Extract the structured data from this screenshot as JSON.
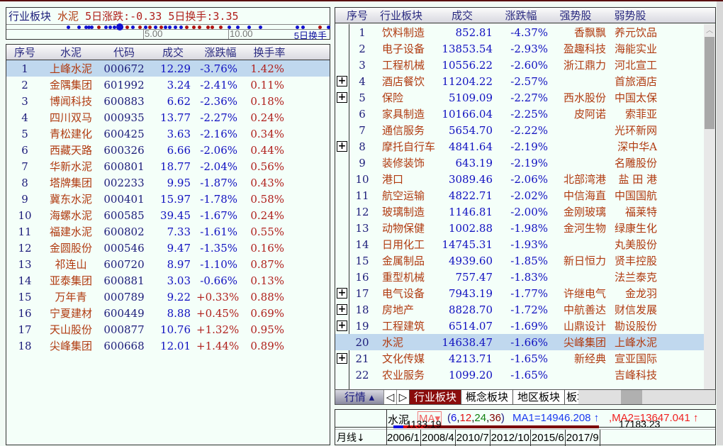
{
  "info": {
    "sector_label": "行业板块",
    "sector_name": "水泥",
    "change5_label": "5日涨跌:-0.33",
    "turnover5_label": "5日换手:3.35",
    "axis_ticks": [
      "5.00",
      "10.00"
    ],
    "axis_label": "5日换手"
  },
  "left_table": {
    "headers": [
      "序号",
      "水泥",
      "代码",
      "成交",
      "涨跌幅",
      "换手率"
    ],
    "rows": [
      [
        "1",
        "上峰水泥",
        "000672",
        "12.29",
        "-3.76%",
        "1.42%"
      ],
      [
        "2",
        "金隅集团",
        "601992",
        "3.24",
        "-2.41%",
        "0.11%"
      ],
      [
        "3",
        "博闻科技",
        "600883",
        "6.62",
        "-2.36%",
        "0.18%"
      ],
      [
        "4",
        "四川双马",
        "000935",
        "13.77",
        "-2.27%",
        "0.24%"
      ],
      [
        "5",
        "青松建化",
        "600425",
        "3.63",
        "-2.16%",
        "0.34%"
      ],
      [
        "6",
        "西藏天路",
        "600326",
        "6.66",
        "-2.06%",
        "0.44%"
      ],
      [
        "7",
        "华新水泥",
        "600801",
        "18.77",
        "-2.04%",
        "0.56%"
      ],
      [
        "8",
        "塔牌集团",
        "002233",
        "9.95",
        "-1.87%",
        "0.43%"
      ],
      [
        "9",
        "冀东水泥",
        "000401",
        "15.97",
        "-1.78%",
        "0.58%"
      ],
      [
        "10",
        "海螺水泥",
        "600585",
        "39.45",
        "-1.67%",
        "0.24%"
      ],
      [
        "11",
        "福建水泥",
        "600802",
        "7.33",
        "-1.61%",
        "0.55%"
      ],
      [
        "12",
        "金圆股份",
        "000546",
        "9.47",
        "-1.35%",
        "0.16%"
      ],
      [
        "13",
        "祁连山",
        "600720",
        "8.97",
        "-1.10%",
        "0.87%"
      ],
      [
        "14",
        "亚泰集团",
        "600881",
        "3.03",
        "-0.66%",
        "0.13%"
      ],
      [
        "15",
        "万年青",
        "000789",
        "9.22",
        "+0.33%",
        "0.88%"
      ],
      [
        "16",
        "宁夏建材",
        "600449",
        "8.88",
        "+0.45%",
        "0.69%"
      ],
      [
        "17",
        "天山股份",
        "000877",
        "10.76",
        "+1.32%",
        "0.95%"
      ],
      [
        "18",
        "尖峰集团",
        "600668",
        "12.01",
        "+1.44%",
        "0.89%"
      ]
    ]
  },
  "right_table": {
    "headers": [
      "序号",
      "行业板块",
      "成交",
      "涨跌幅",
      "强势股",
      "弱势股"
    ],
    "rows": [
      [
        "1",
        "饮料制造",
        "852.81",
        "-4.37%",
        "香飘飘",
        "养元饮品",
        false
      ],
      [
        "2",
        "电子设备",
        "13853.54",
        "-2.93%",
        "盈趣科技",
        "海能实业",
        false
      ],
      [
        "3",
        "工程机械",
        "10556.22",
        "-2.60%",
        "浙江鼎力",
        "河北宣工",
        false
      ],
      [
        "4",
        "酒店餐饮",
        "11204.22",
        "-2.57%",
        "",
        "首旅酒店",
        true
      ],
      [
        "5",
        "保险",
        "5109.09",
        "-2.27%",
        "西水股份",
        "中国太保",
        true
      ],
      [
        "6",
        "家具制造",
        "10166.04",
        "-2.25%",
        "皮阿诺",
        "索菲亚",
        false
      ],
      [
        "7",
        "通信服务",
        "5654.70",
        "-2.22%",
        "",
        "光环新网",
        false
      ],
      [
        "8",
        "摩托自行车",
        "4841.64",
        "-2.19%",
        "",
        "深中华A",
        true
      ],
      [
        "9",
        "装修装饰",
        "643.19",
        "-2.19%",
        "",
        "名雕股份",
        false
      ],
      [
        "10",
        "港口",
        "3089.46",
        "-2.06%",
        "北部湾港",
        "盐 田 港",
        false
      ],
      [
        "11",
        "航空运输",
        "4822.71",
        "-2.02%",
        "中信海直",
        "中国国航",
        false
      ],
      [
        "12",
        "玻璃制造",
        "1146.81",
        "-2.00%",
        "金刚玻璃",
        "福莱特",
        false
      ],
      [
        "13",
        "动物保健",
        "1002.88",
        "-1.98%",
        "金河生物",
        "绿康生化",
        false
      ],
      [
        "14",
        "日用化工",
        "14745.31",
        "-1.93%",
        "",
        "丸美股份",
        false
      ],
      [
        "15",
        "金属制品",
        "4939.60",
        "-1.85%",
        "新日恒力",
        "贤丰控股",
        false
      ],
      [
        "16",
        "重型机械",
        "757.47",
        "-1.83%",
        "",
        "法兰泰克",
        false
      ],
      [
        "17",
        "电气设备",
        "7943.19",
        "-1.77%",
        "许继电气",
        "金龙羽",
        true
      ],
      [
        "18",
        "房地产",
        "8828.70",
        "-1.72%",
        "中航善达",
        "财信发展",
        true
      ],
      [
        "19",
        "工程建筑",
        "6514.07",
        "-1.69%",
        "山鼎设计",
        "勘设股份",
        true
      ],
      [
        "20",
        "水泥",
        "14638.47",
        "-1.66%",
        "尖峰集团",
        "上峰水泥",
        false
      ],
      [
        "21",
        "文化传媒",
        "4213.71",
        "-1.65%",
        "新经典",
        "宣亚国际",
        true
      ],
      [
        "22",
        "农业服务",
        "1099.20",
        "-1.65%",
        "",
        "吉峰科技",
        false
      ]
    ]
  },
  "tabs": {
    "quote": "行情 ▴",
    "prev": "◁",
    "next": "▷",
    "items": [
      "行业板块",
      "概念板块",
      "地区板块",
      "板块"
    ]
  },
  "chart": {
    "name": "水泥",
    "indicator": "MA▾",
    "params_open": "(",
    "p1": "6",
    "p2": "12",
    "p3": "24",
    "p4": "36",
    "params_close": ")",
    "ma1": "MA1=14946.208 ↑",
    "ma2": ",MA2=13647.041 ↑",
    "low": "1133.19",
    "high": "17183.23",
    "period": "月线↓",
    "dates": [
      "2006/1",
      "2008/4",
      "2010/7",
      "2012/10",
      "2015/6",
      "2017/9"
    ]
  },
  "colors": {
    "up": "#b0201c",
    "down": "#1010c0",
    "name": "#b03a10",
    "selected": "#c0d8ee"
  }
}
